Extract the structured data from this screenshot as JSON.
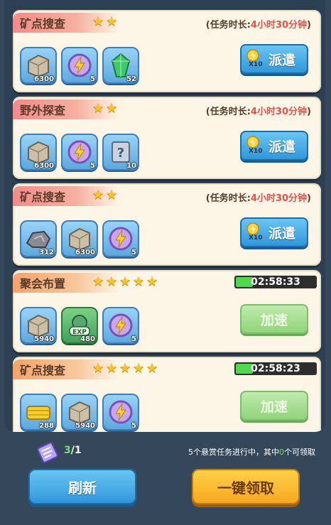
{
  "colors": {
    "accent_red": "#e8504a",
    "progress_green": "#4fd84c",
    "button_blue": "#2e95da",
    "button_orange": "#f6a61f"
  },
  "missions": [
    {
      "title": "矿点搜查",
      "stars": 2,
      "duration_prefix": "(任务时长:",
      "duration_value": "4小时30分钟",
      "duration_suffix": ")",
      "rewards": [
        {
          "icon": "stone-icon",
          "count": "6300"
        },
        {
          "icon": "energy-icon",
          "count": "5"
        },
        {
          "icon": "green-crystal-icon",
          "count": "52"
        }
      ],
      "action": {
        "type": "dispatch",
        "label": "派遣",
        "cost_icon": "speedup-token-icon",
        "cost": "X10"
      }
    },
    {
      "title": "野外探查",
      "stars": 2,
      "duration_prefix": "(任务时长:",
      "duration_value": "4小时30分钟",
      "duration_suffix": ")",
      "rewards": [
        {
          "icon": "stone-icon",
          "count": "6300"
        },
        {
          "icon": "energy-icon",
          "count": "5"
        },
        {
          "icon": "scroll-icon",
          "count": "10"
        }
      ],
      "action": {
        "type": "dispatch",
        "label": "派遣",
        "cost_icon": "speedup-token-icon",
        "cost": "X10"
      }
    },
    {
      "title": "矿点搜查",
      "stars": 2,
      "duration_prefix": "(任务时长:",
      "duration_value": "4小时30分钟",
      "duration_suffix": ")",
      "rewards": [
        {
          "icon": "ore-icon",
          "count": "312"
        },
        {
          "icon": "stone-icon",
          "count": "6300"
        },
        {
          "icon": "energy-icon",
          "count": "5"
        }
      ],
      "action": {
        "type": "dispatch",
        "label": "派遣",
        "cost_icon": "speedup-token-icon",
        "cost": "X10"
      }
    },
    {
      "title": "聚会布置",
      "stars": 5,
      "timer": "02:58:33",
      "rewards": [
        {
          "icon": "stone-icon",
          "count": "5940"
        },
        {
          "icon": "exp-icon",
          "count": "480"
        },
        {
          "icon": "energy-icon",
          "count": "5"
        }
      ],
      "action": {
        "type": "speedup",
        "label": "加速"
      }
    },
    {
      "title": "矿点搜查",
      "stars": 5,
      "timer": "02:58:23",
      "rewards": [
        {
          "icon": "hay-icon",
          "count": "288"
        },
        {
          "icon": "stone-icon",
          "count": "5940"
        },
        {
          "icon": "energy-icon",
          "count": "5"
        }
      ],
      "action": {
        "type": "speedup",
        "label": "加速"
      }
    }
  ],
  "footer": {
    "tickets_current": "3",
    "tickets_sep": "/1",
    "status_prefix": "5个悬赏任务进行中，其中",
    "status_count": "0",
    "status_suffix": "个可领取",
    "refresh_label": "刷新",
    "claim_all_label": "一键领取"
  }
}
